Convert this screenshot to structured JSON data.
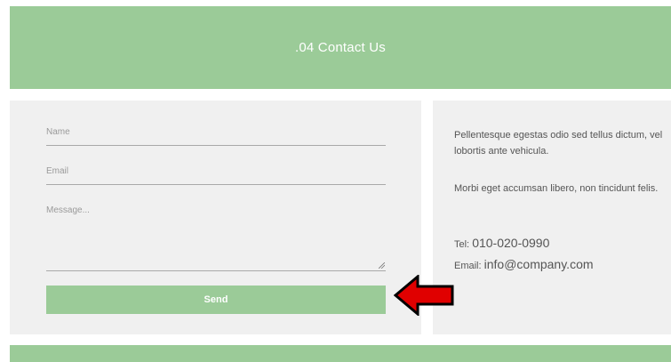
{
  "header": {
    "title": ".04 Contact Us"
  },
  "form": {
    "name_placeholder": "Name",
    "email_placeholder": "Email",
    "message_placeholder": "Message...",
    "send_label": "Send"
  },
  "info": {
    "paragraph1": "Pellentesque egestas odio sed tellus dictum, vel lobortis ante vehicula.",
    "paragraph2": "Morbi eget accumsan libero, non tincidunt felis.",
    "tel_label": "Tel: ",
    "tel_value": "010-020-0990",
    "email_label": "Email: ",
    "email_value": "info@company.com"
  },
  "annotation": {
    "arrow_color": "#e00000",
    "arrow_icon": "arrow-left-icon"
  },
  "colors": {
    "accent": "#9bcb98",
    "panel": "#f0f0f0"
  }
}
